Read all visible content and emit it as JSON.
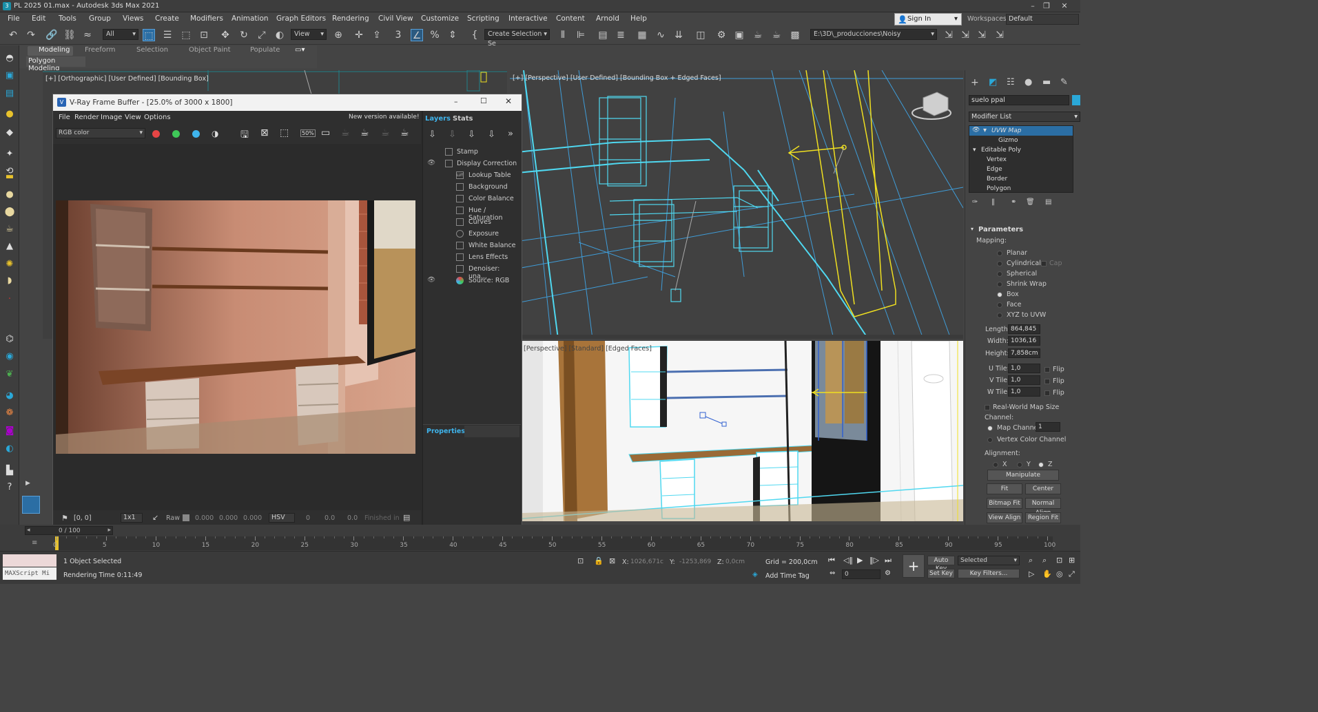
{
  "app": {
    "title": "PL 2025 01.max - Autodesk 3ds Max 2021"
  },
  "menu": [
    "File",
    "Edit",
    "Tools",
    "Group",
    "Views",
    "Create",
    "Modifiers",
    "Animation",
    "Graph Editors",
    "Rendering",
    "Civil View",
    "Customize",
    "Scripting",
    "Interactive",
    "Content",
    "Arnold",
    "Help"
  ],
  "account": {
    "sign_in": "Sign In",
    "workspaces_label": "Workspaces:",
    "workspace": "Default"
  },
  "toolbar": {
    "filter": "All",
    "view": "View",
    "selection_set": "Create Selection Se",
    "path": "E:\\3D\\_producciones\\Noisy"
  },
  "ribbon": {
    "tabs": [
      "Modeling",
      "Freeform",
      "Selection",
      "Object Paint",
      "Populate"
    ],
    "active_tab": "Modeling",
    "panel": "Polygon Modeling"
  },
  "viewports": {
    "top_left": "[+] [Orthographic] [User Defined] [Bounding Box]",
    "top_right": "[+] [Perspective] [User Defined] [Bounding Box + Edged Faces]",
    "bottom_right": "[Perspective] [Standard] [Edged Faces]"
  },
  "vfb": {
    "title": "V-Ray Frame Buffer - [25.0% of 3000 x 1800]",
    "menu": [
      "File",
      "Render",
      "Image",
      "View",
      "Options"
    ],
    "new_version": "New version available!",
    "channel": "RGB color",
    "zoom": "50%",
    "status": {
      "coords": "[0, 0]",
      "ratio": "1x1",
      "raw_label": "Raw",
      "v1": "0.000",
      "v2": "0.000",
      "v3": "0.000",
      "mode": "HSV",
      "h": "0",
      "s": "0.0",
      "v": "0.0",
      "finished": "Finished in"
    },
    "side_tabs": [
      "Layers",
      "Stats"
    ],
    "layers": [
      "Stamp",
      "Display Correction",
      "Lookup Table",
      "Background",
      "Color Balance",
      "Hue / Saturation",
      "Curves",
      "Exposure",
      "White Balance",
      "Lens Effects",
      "Denoiser: una...",
      "Source: RGB"
    ],
    "properties": "Properties"
  },
  "command_panel": {
    "object_name": "suelo ppal",
    "modifier_list": "Modifier List",
    "stack": [
      "UVW Map",
      "Gizmo",
      "Editable Poly",
      "Vertex",
      "Edge",
      "Border",
      "Polygon"
    ],
    "rollout": "Parameters",
    "mapping_label": "Mapping:",
    "mapping": [
      "Planar",
      "Cylindrical",
      "Spherical",
      "Shrink Wrap",
      "Box",
      "Face",
      "XYZ to UVW"
    ],
    "mapping_selected": "Box",
    "cap": "Cap",
    "length_label": "Length:",
    "length": "864,845",
    "width_label": "Width:",
    "width": "1036,16",
    "height_label": "Height:",
    "height": "7,858cm",
    "utile_label": "U Tile:",
    "utile": "1,0",
    "vtile_label": "V Tile:",
    "vtile": "1,0",
    "wtile_label": "W Tile:",
    "wtile": "1,0",
    "flip": "Flip",
    "real_world": "Real-World Map Size",
    "channel_label": "Channel:",
    "map_channel_label": "Map Channel:",
    "map_channel": "1",
    "vertex_color": "Vertex Color Channel",
    "alignment_label": "Alignment:",
    "axes": [
      "X",
      "Y",
      "Z"
    ],
    "manipulate": "Manipulate",
    "fit": "Fit",
    "center": "Center",
    "bitmap_fit": "Bitmap Fit",
    "normal_align": "Normal Align",
    "view_align": "View Align",
    "region_fit": "Region Fit"
  },
  "timeline": {
    "frame": "0 / 100",
    "ticks": [
      "0",
      "5",
      "10",
      "15",
      "20",
      "25",
      "30",
      "35",
      "40",
      "45",
      "50",
      "55",
      "60",
      "65",
      "70",
      "75",
      "80",
      "85",
      "90",
      "95",
      "100"
    ]
  },
  "status": {
    "maxscript": "MAXScript Mi",
    "selected": "1 Object Selected",
    "render_time": "Rendering Time  0:11:49",
    "x_label": "X:",
    "x": "1026,671c",
    "y_label": "Y:",
    "y": "-1253,869c",
    "z_label": "Z:",
    "z": "0,0cm",
    "grid": "Grid = 200,0cm",
    "add_time_tag": "Add Time Tag",
    "auto_key": "Auto Key",
    "key_mode": "Selected",
    "set_key": "Set Key",
    "key_filters": "Key Filters...",
    "frame_input": "0"
  },
  "colors": {
    "accent": "#2aa8d8",
    "selection_yellow": "#f0e020",
    "wire_cyan": "#4fd8f0",
    "vfb_red": "#e64545",
    "vfb_green": "#3fc858",
    "vfb_blue": "#3fb4ec"
  }
}
